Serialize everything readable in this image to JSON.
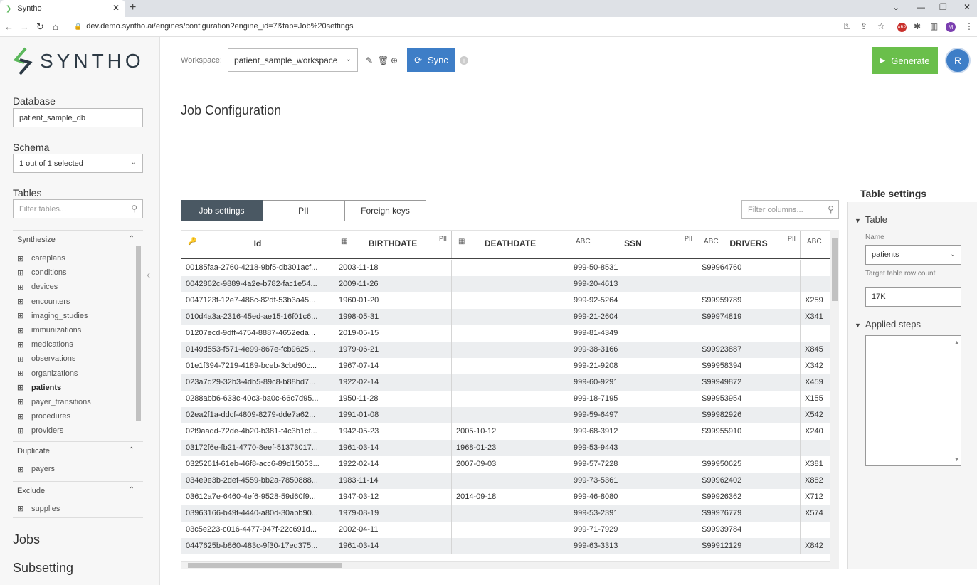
{
  "browser": {
    "tab_title": "Syntho",
    "url": "dev.demo.syntho.ai/engines/configuration?engine_id=7&tab=Job%20settings"
  },
  "brand": {
    "name": "SYNTHO",
    "accent": "#5cb85c",
    "dark": "#2d3a45"
  },
  "sidebar": {
    "database_label": "Database",
    "database_value": "patient_sample_db",
    "schema_label": "Schema",
    "schema_value": "1 out of 1 selected",
    "tables_label": "Tables",
    "tables_filter_placeholder": "Filter tables...",
    "groups": {
      "synthesize": {
        "label": "Synthesize",
        "items": [
          "careplans",
          "conditions",
          "devices",
          "encounters",
          "imaging_studies",
          "immunizations",
          "medications",
          "observations",
          "organizations",
          "patients",
          "payer_transitions",
          "procedures",
          "providers"
        ]
      },
      "duplicate": {
        "label": "Duplicate",
        "items": [
          "payers"
        ]
      },
      "exclude": {
        "label": "Exclude",
        "items": [
          "supplies"
        ]
      }
    },
    "jobs_label": "Jobs",
    "subsetting_label": "Subsetting"
  },
  "topbar": {
    "workspace_label": "Workspace:",
    "workspace_value": "patient_sample_workspace",
    "sync_label": "Sync",
    "generate_label": "Generate",
    "avatar_initial": "R",
    "sync_color": "#3e7ec7",
    "generate_color": "#6abf4b"
  },
  "main": {
    "title": "Job Configuration",
    "tabs": [
      "Job settings",
      "PII",
      "Foreign keys"
    ],
    "filter_columns_placeholder": "Filter columns...",
    "columns": [
      {
        "name": "Id",
        "type": "key",
        "pii": ""
      },
      {
        "name": "BIRTHDATE",
        "type": "date",
        "pii": "PII"
      },
      {
        "name": "DEATHDATE",
        "type": "date",
        "pii": ""
      },
      {
        "name": "SSN",
        "type": "text",
        "pii": "PII"
      },
      {
        "name": "DRIVERS",
        "type": "text",
        "pii": "PII"
      },
      {
        "name": "",
        "type": "text",
        "pii": ""
      }
    ],
    "type_glyphs": {
      "key": "🔑",
      "date": "▦",
      "text": "ABC"
    },
    "rows": [
      [
        "00185faa-2760-4218-9bf5-db301acf...",
        "2003-11-18",
        "",
        "999-50-8531",
        "S99964760",
        ""
      ],
      [
        "0042862c-9889-4a2e-b782-fac1e54...",
        "2009-11-26",
        "",
        "999-20-4613",
        "",
        ""
      ],
      [
        "0047123f-12e7-486c-82df-53b3a45...",
        "1960-01-20",
        "",
        "999-92-5264",
        "S99959789",
        "X259"
      ],
      [
        "010d4a3a-2316-45ed-ae15-16f01c6...",
        "1998-05-31",
        "",
        "999-21-2604",
        "S99974819",
        "X341"
      ],
      [
        "01207ecd-9dff-4754-8887-4652eda...",
        "2019-05-15",
        "",
        "999-81-4349",
        "",
        ""
      ],
      [
        "0149d553-f571-4e99-867e-fcb9625...",
        "1979-06-21",
        "",
        "999-38-3166",
        "S99923887",
        "X845"
      ],
      [
        "01e1f394-7219-4189-bceb-3cbd90c...",
        "1967-07-14",
        "",
        "999-21-9208",
        "S99958394",
        "X342"
      ],
      [
        "023a7d29-32b3-4db5-89c8-b88bd7...",
        "1922-02-14",
        "",
        "999-60-9291",
        "S99949872",
        "X459"
      ],
      [
        "0288abb6-633c-40c3-ba0c-66c7d95...",
        "1950-11-28",
        "",
        "999-18-7195",
        "S99953954",
        "X155"
      ],
      [
        "02ea2f1a-ddcf-4809-8279-dde7a62...",
        "1991-01-08",
        "",
        "999-59-6497",
        "S99982926",
        "X542"
      ],
      [
        "02f9aadd-72de-4b20-b381-f4c3b1cf...",
        "1942-05-23",
        "2005-10-12",
        "999-68-3912",
        "S99955910",
        "X240"
      ],
      [
        "03172f6e-fb21-4770-8eef-51373017...",
        "1961-03-14",
        "1968-01-23",
        "999-53-9443",
        "",
        ""
      ],
      [
        "0325261f-61eb-46f8-acc6-89d15053...",
        "1922-02-14",
        "2007-09-03",
        "999-57-7228",
        "S99950625",
        "X381"
      ],
      [
        "034e9e3b-2def-4559-bb2a-7850888...",
        "1983-11-14",
        "",
        "999-73-5361",
        "S99962402",
        "X882"
      ],
      [
        "03612a7e-6460-4ef6-9528-59d60f9...",
        "1947-03-12",
        "2014-09-18",
        "999-46-8080",
        "S99926362",
        "X712"
      ],
      [
        "03963166-b49f-4440-a80d-30abb90...",
        "1979-08-19",
        "",
        "999-53-2391",
        "S99976779",
        "X574"
      ],
      [
        "03c5e223-c016-4477-947f-22c691d...",
        "2002-04-11",
        "",
        "999-71-7929",
        "S99939784",
        ""
      ],
      [
        "0447625b-b860-483c-9f30-17ed375...",
        "1961-03-14",
        "",
        "999-63-3313",
        "S99912129",
        "X842"
      ]
    ]
  },
  "table_settings": {
    "title": "Table settings",
    "table_section": "Table",
    "name_label": "Name",
    "name_value": "patients",
    "row_count_label": "Target table row count",
    "row_count_value": "17K",
    "applied_steps_label": "Applied steps"
  }
}
